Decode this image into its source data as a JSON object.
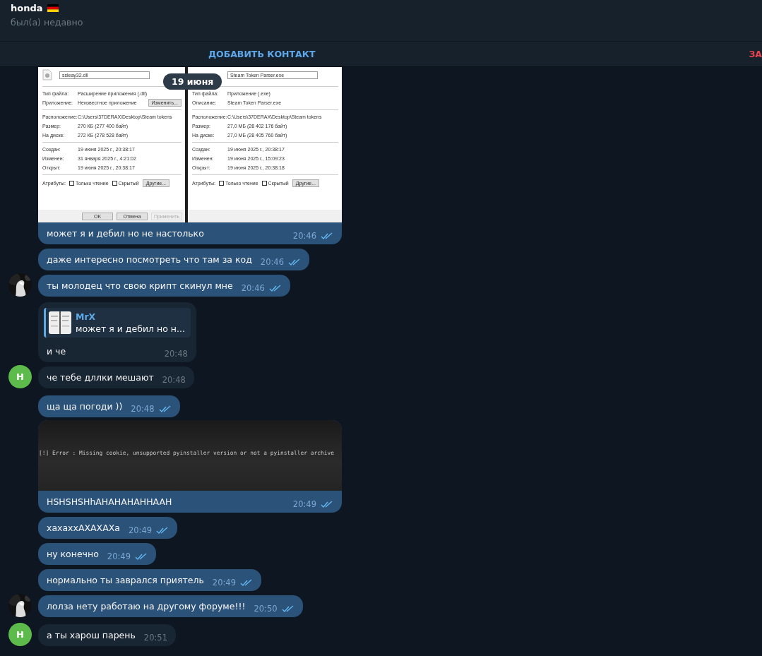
{
  "header": {
    "title": "honda",
    "status": "был(а) недавно"
  },
  "actions": [
    {
      "label": "ДОБАВИТЬ КОНТАКТ",
      "kind": "primary"
    },
    {
      "label": "ЗА",
      "kind": "danger"
    }
  ],
  "date_badge": "19 июня",
  "messages": [
    {
      "kind": "dialogs",
      "outgoing": true,
      "text": "может я и дебил но не настолько",
      "time": "20:46",
      "read": true,
      "dialogs": [
        {
          "name": "ssleay32.dll",
          "groups": [
            [
              {
                "label": "Тип файла:",
                "value": "Расширение приложения (.dll)"
              },
              {
                "label": "Приложение:",
                "value": "Неизвестное приложение",
                "button": "Изменить..."
              }
            ],
            [
              {
                "label": "Расположение:",
                "value": "C:\\Users\\37DERAX\\Desktop\\Steam tokens"
              },
              {
                "label": "Размер:",
                "value": "270 КБ (277 400 байт)"
              },
              {
                "label": "На диске:",
                "value": "272 КБ (278 528 байт)"
              }
            ],
            [
              {
                "label": "Создан:",
                "value": "19 июня 2025 г., 20:38:17"
              },
              {
                "label": "Изменен:",
                "value": "31 января 2025 г., 4:21:02"
              },
              {
                "label": "Открыт:",
                "value": "19 июня 2025 г., 20:38:17"
              }
            ]
          ],
          "attributes": {
            "label": "Атрибуты:",
            "checks": [
              {
                "label": "Только чтение",
                "checked": false
              },
              {
                "label": "Скрытый",
                "checked": false
              }
            ],
            "button": "Другие..."
          },
          "buttons": [
            {
              "label": "OK",
              "disabled": false
            },
            {
              "label": "Отмена",
              "disabled": false
            },
            {
              "label": "Применить",
              "disabled": true
            }
          ]
        },
        {
          "name": "Steam Token Parser.exe",
          "groups": [
            [
              {
                "label": "Тип файла:",
                "value": "Приложение (.exe)"
              },
              {
                "label": "Описание:",
                "value": "Steam Token Parser.exe"
              }
            ],
            [
              {
                "label": "Расположение:",
                "value": "C:\\Users\\37DERAX\\Desktop\\Steam tokens"
              },
              {
                "label": "Размер:",
                "value": "27,0 МБ (28 402 176 байт)"
              },
              {
                "label": "На диске:",
                "value": "27,0 МБ (28 405 760 байт)"
              }
            ],
            [
              {
                "label": "Создан:",
                "value": "19 июня 2025 г., 20:38:17"
              },
              {
                "label": "Изменен:",
                "value": "19 июня 2025 г., 15:09:23"
              },
              {
                "label": "Открыт:",
                "value": "19 июня 2025 г., 20:38:18"
              }
            ]
          ],
          "attributes": {
            "label": "Атрибуты:",
            "checks": [
              {
                "label": "Только чтение",
                "checked": false
              },
              {
                "label": "Скрытый",
                "checked": false
              }
            ],
            "button": "Другие..."
          }
        }
      ]
    },
    {
      "kind": "text",
      "outgoing": true,
      "text": "даже интересно посмотреть что там за код",
      "time": "20:46",
      "read": true
    },
    {
      "kind": "text",
      "outgoing": true,
      "text": "ты молодец что свою крипт скинул мне",
      "time": "20:46",
      "read": true
    },
    {
      "kind": "reply",
      "outgoing": false,
      "reply": {
        "author": "MrX",
        "text": "может я и дебил но н..."
      },
      "text": "и че",
      "time": "20:48"
    },
    {
      "kind": "text",
      "outgoing": false,
      "text": "че тебе дллки мешают",
      "time": "20:48",
      "avatar": {
        "kind": "letter",
        "letter": "H"
      }
    },
    {
      "kind": "text",
      "outgoing": true,
      "text": "ща ща погоди ))",
      "time": "20:48",
      "read": true
    },
    {
      "kind": "terminal",
      "outgoing": true,
      "lines": [
        "[!] Error : Missing cookie, unsupported pyinstaller version or not a pyinstaller archive"
      ],
      "text": "HSHSHSHhAHAHAHAHHAAH",
      "time": "20:49",
      "read": true
    },
    {
      "kind": "text",
      "outgoing": true,
      "text": "хахаххАХАХАХа",
      "time": "20:49",
      "read": true
    },
    {
      "kind": "text",
      "outgoing": true,
      "text": "ну конечно",
      "time": "20:49",
      "read": true
    },
    {
      "kind": "text",
      "outgoing": true,
      "text": "нормально ты заврался приятель",
      "time": "20:49",
      "read": true
    },
    {
      "kind": "text",
      "outgoing": true,
      "text": "лолза нету работаю на другому форуме!!!",
      "time": "20:50",
      "read": true
    },
    {
      "kind": "text",
      "outgoing": false,
      "text": "а ты харош парень",
      "time": "20:51",
      "avatar": {
        "kind": "letter",
        "letter": "H"
      }
    }
  ]
}
